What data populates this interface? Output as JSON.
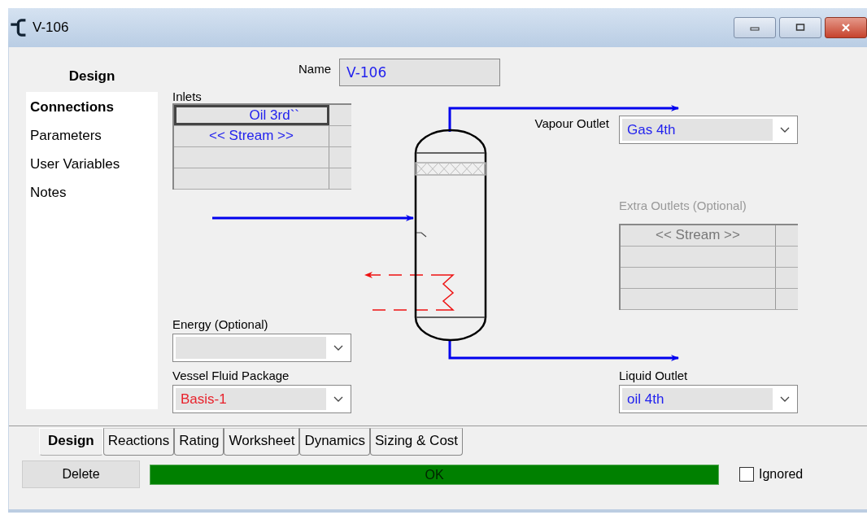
{
  "window": {
    "title": "V-106"
  },
  "sidebar": {
    "heading": "Design",
    "items": [
      {
        "label": "Connections",
        "selected": true
      },
      {
        "label": "Parameters",
        "selected": false
      },
      {
        "label": "User Variables",
        "selected": false
      },
      {
        "label": "Notes",
        "selected": false
      }
    ]
  },
  "name": {
    "label": "Name",
    "value": "V-106"
  },
  "inlets": {
    "label": "Inlets",
    "rows": [
      {
        "value": "Oil 3rd``",
        "selected": true
      },
      {
        "value": "<< Stream >>",
        "selected": false
      }
    ]
  },
  "vapour_outlet": {
    "label": "Vapour Outlet",
    "value": "Gas 4th"
  },
  "extra_outlets": {
    "label": "Extra Outlets (Optional)",
    "disabled": true,
    "rows": [
      {
        "value": "<< Stream >>",
        "selected": false
      }
    ]
  },
  "energy": {
    "label": "Energy (Optional)"
  },
  "fluid_package": {
    "label": "Vessel Fluid Package",
    "value": "Basis-1"
  },
  "liquid_outlet": {
    "label": "Liquid Outlet",
    "value": "oil 4th"
  },
  "tabs": [
    {
      "label": "Design",
      "selected": true
    },
    {
      "label": "Reactions",
      "selected": false
    },
    {
      "label": "Rating",
      "selected": false
    },
    {
      "label": "Worksheet",
      "selected": false
    },
    {
      "label": "Dynamics",
      "selected": false
    },
    {
      "label": "Sizing & Cost",
      "selected": false
    }
  ],
  "delete_button": "Delete",
  "status": {
    "text": "OK"
  },
  "ignored": {
    "label": "Ignored",
    "checked": false
  }
}
